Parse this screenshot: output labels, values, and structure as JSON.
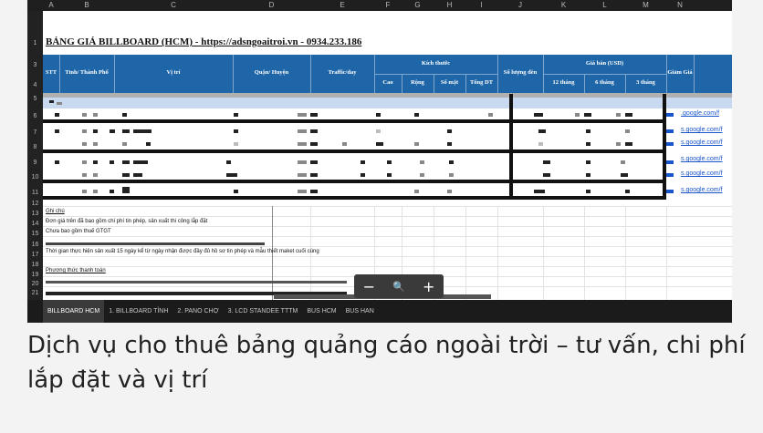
{
  "sheet": {
    "columns": [
      "A",
      "B",
      "C",
      "D",
      "E",
      "F",
      "G",
      "H",
      "I",
      "J",
      "K",
      "L",
      "M",
      "N"
    ],
    "rows": [
      "1",
      "",
      "3",
      "4",
      "5",
      "6",
      "7",
      "8",
      "9",
      "10",
      "11",
      "12",
      "13",
      "14",
      "15",
      "16",
      "17",
      "18",
      "19",
      "20",
      "21"
    ],
    "title": "BẢNG GIÁ BILLBOARD (HCM) - https://adsngoaitroi.vn - 0934.233.186",
    "headers": {
      "stt": "STT",
      "tinh": "Tỉnh/ Thành Phố",
      "vitri": "Vị trí",
      "quan": "Quận/ Huyện",
      "traffic": "Traffic/day",
      "kichthuoc": "Kích thước",
      "cao": "Cao",
      "rong": "Rộng",
      "somat": "Số mặt",
      "tongdt": "Tổng DT",
      "soluong": "Số lượng đèn",
      "giaban": "Giá bán (USD)",
      "m12": "12 tháng",
      "m6": "6 tháng",
      "m3": "3 tháng",
      "giamgia": "Giảm Giá"
    },
    "links": [
      ".google.com/f",
      "s.google.com/f",
      "s.google.com/f",
      "s.google.com/f",
      "s.google.com/f",
      "s.google.com/f"
    ],
    "notes": {
      "ghichu": "Ghi chú",
      "line1": "Đơn giá trên đã bao gồm chi phí tin phép, sản xuất thi công lắp đặt",
      "line2": "Chưa bao gồm thuế GTGT",
      "line3": "Thời gian thực hiện sản xuất 15 ngày kể từ ngày nhận được đầy đủ hồ sơ tin phép và mẫu thiết maket cuối cùng",
      "pttt": "Phương thức thanh toán"
    },
    "zoom": {
      "minus": "−",
      "search": "🔍",
      "plus": "+"
    },
    "tabs": [
      "BILLBOARD HCM",
      "1. BILLBOARD TỈNH",
      "2. PANO CHỢ",
      "3. LCD STANDEE TTTM",
      "BUS HCM",
      "BUS HAN"
    ],
    "active_tab": "BILLBOARD HCM"
  },
  "caption": "Dịch vụ cho thuê bảng quảng cáo ngoài trời – tư vấn, chi phí lắp đặt và vị trí"
}
